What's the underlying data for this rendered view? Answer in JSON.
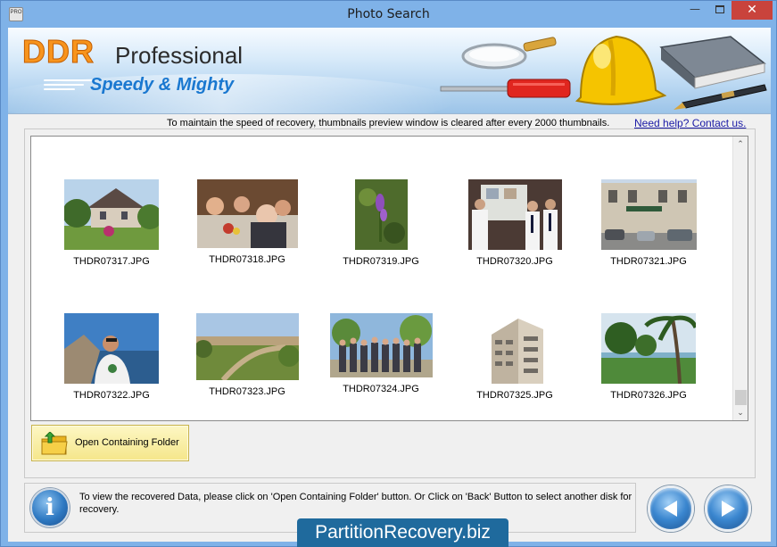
{
  "window": {
    "title": "Photo Search",
    "app_icon_text": "PRO",
    "minimize_glyph": "—",
    "close_glyph": "✕"
  },
  "banner": {
    "brand": "DDR",
    "product": "Professional",
    "tagline": "Speedy & Mighty",
    "icons": [
      "magnifier-icon",
      "screwdriver-icon",
      "hard-hat-icon",
      "book-icon",
      "pen-icon"
    ]
  },
  "notice": {
    "text": "To maintain the speed of recovery, thumbnails preview window is cleared after every 2000 thumbnails.",
    "help_link": "Need help? Contact us."
  },
  "thumbnails": [
    {
      "filename": "THDR07317.JPG",
      "scene": "house-garden"
    },
    {
      "filename": "THDR07318.JPG",
      "scene": "dinner-party"
    },
    {
      "filename": "THDR07319.JPG",
      "scene": "purple-flower"
    },
    {
      "filename": "THDR07320.JPG",
      "scene": "exhibition-people"
    },
    {
      "filename": "THDR07321.JPG",
      "scene": "street-building"
    },
    {
      "filename": "THDR07322.JPG",
      "scene": "man-seaside"
    },
    {
      "filename": "THDR07323.JPG",
      "scene": "park-path"
    },
    {
      "filename": "THDR07324.JPG",
      "scene": "group-photo"
    },
    {
      "filename": "THDR07325.JPG",
      "scene": "tall-building"
    },
    {
      "filename": "THDR07326.JPG",
      "scene": "tropical-park"
    }
  ],
  "scrollbar": {
    "up_glyph": "⌃",
    "down_glyph": "⌄",
    "position": 0.95
  },
  "actions": {
    "open_folder": "Open Containing Folder"
  },
  "footer": {
    "info_glyph": "i",
    "instructions": "To view the recovered Data, please click on 'Open Containing Folder' button. Or Click on 'Back' Button to select another disk for recovery."
  },
  "watermark": "PartitionRecovery.biz",
  "colors": {
    "titlebar": "#7fb2e8",
    "close_button": "#c9433c",
    "brand_orange": "#f7941d",
    "tagline_blue": "#1a78d0",
    "link": "#1a1aa6",
    "watermark_bg": "#1f6a9d"
  }
}
